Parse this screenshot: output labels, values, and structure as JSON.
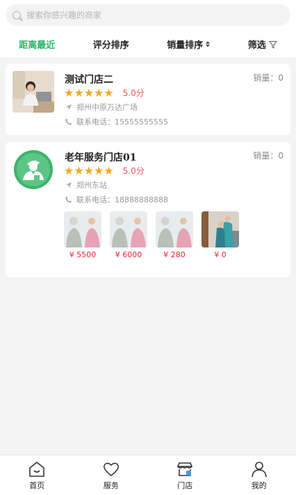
{
  "search": {
    "placeholder": "搜索你感兴趣的商家"
  },
  "sort": {
    "distance": "距离最近",
    "rating": "评分排序",
    "sales": "销量排序",
    "filter": "筛选"
  },
  "stores": [
    {
      "name": "测试门店二",
      "sales": "销量：0",
      "stars": "★★★★★",
      "score": "5.0分",
      "address": "郑州中原万达广场",
      "phone": "联系电话：15555555555"
    },
    {
      "name": "老年服务门店01",
      "sales": "销量：0",
      "stars": "★★★★★",
      "score": "5.0分",
      "address": "郑州东站",
      "phone": "联系电话：18888888888",
      "services": [
        {
          "price": "¥ 5500"
        },
        {
          "price": "¥ 6000"
        },
        {
          "price": "¥ 280"
        },
        {
          "price": "¥ 0"
        }
      ]
    }
  ],
  "tabs": {
    "home": "首页",
    "service": "服务",
    "store": "门店",
    "mine": "我的"
  },
  "colors": {
    "accent": "#2bb56a",
    "star": "#f5a623",
    "price": "#e22233"
  }
}
